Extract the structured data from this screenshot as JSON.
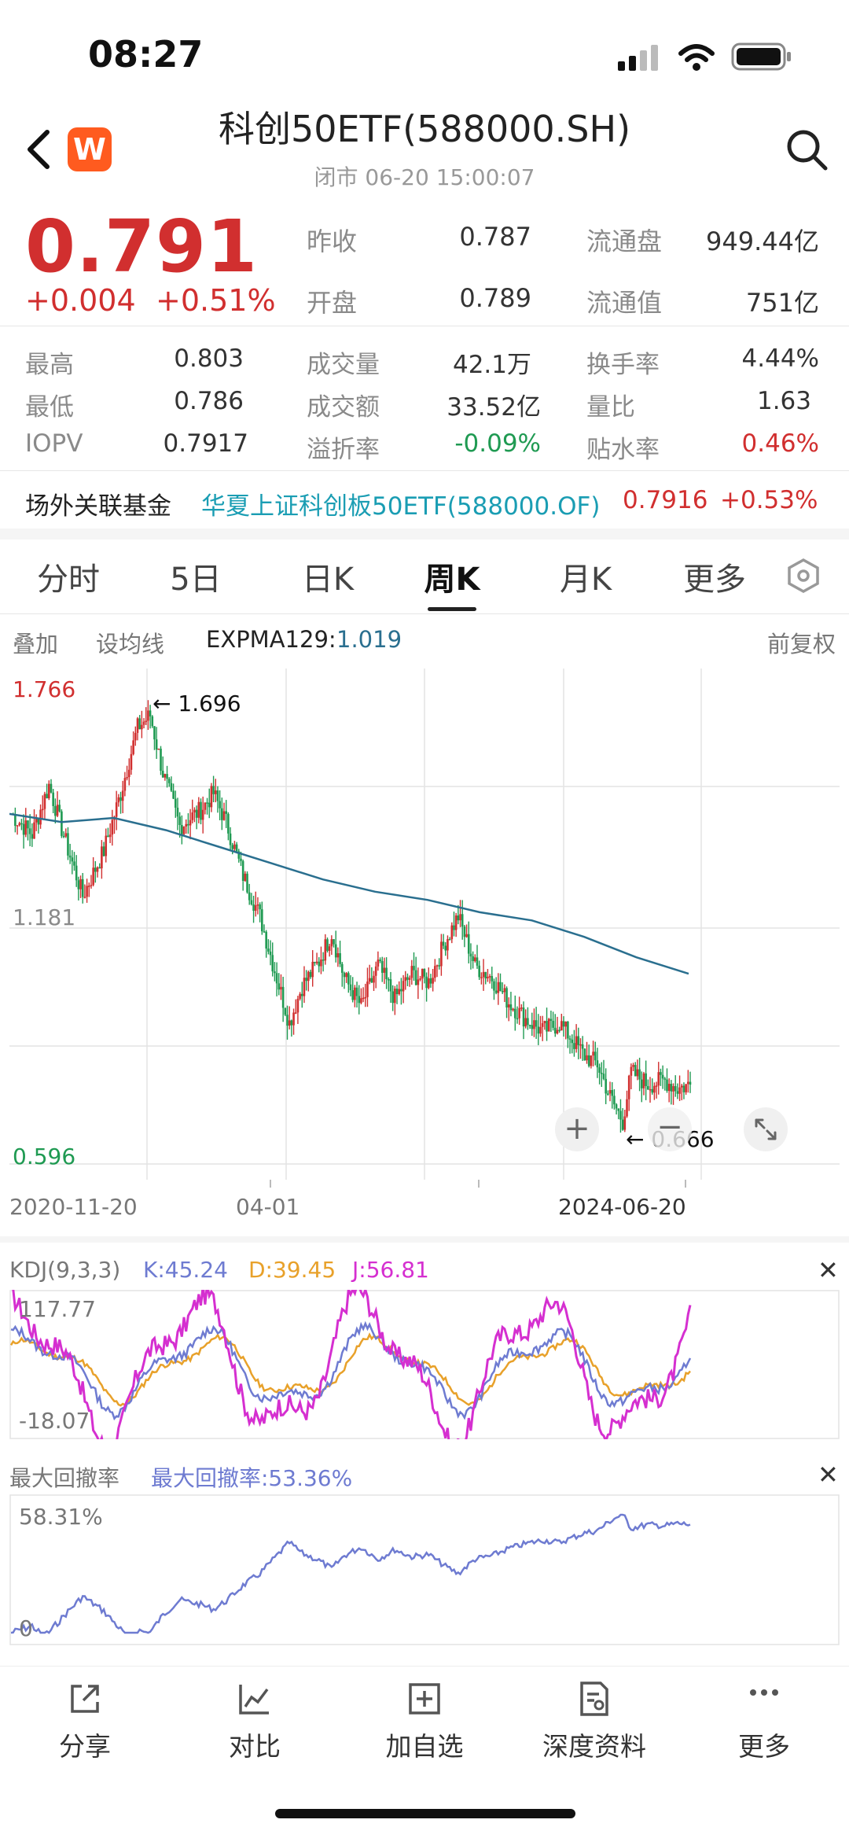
{
  "status_bar": {
    "time": "08:27"
  },
  "header": {
    "title": "科创50ETF(588000.SH)",
    "subtitle": "闭市 06-20 15:00:07",
    "logo_letter": "W"
  },
  "quote": {
    "price": "0.791",
    "change": "+0.004",
    "change_pct": "+0.51%",
    "prev_close_label": "昨收",
    "prev_close": "0.787",
    "open_label": "开盘",
    "open": "0.789",
    "float_shares_label": "流通盘",
    "float_shares": "949.44亿",
    "float_value_label": "流通值",
    "float_value": "751亿"
  },
  "stats": {
    "high_label": "最高",
    "high": "0.803",
    "low_label": "最低",
    "low": "0.786",
    "iopv_label": "IOPV",
    "iopv": "0.7917",
    "volume_label": "成交量",
    "volume": "42.1万",
    "amount_label": "成交额",
    "amount": "33.52亿",
    "premium_label": "溢折率",
    "premium": "-0.09%",
    "turnover_label": "换手率",
    "turnover": "4.44%",
    "vol_ratio_label": "量比",
    "vol_ratio": "1.63",
    "discount_label": "贴水率",
    "discount": "0.46%"
  },
  "related_fund": {
    "label": "场外关联基金",
    "name": "华夏上证科创板50ETF(588000.OF)",
    "price": "0.7916",
    "change": "+0.53%"
  },
  "tabs": [
    {
      "label": "分时"
    },
    {
      "label": "5日"
    },
    {
      "label": "日K"
    },
    {
      "label": "周K"
    },
    {
      "label": "月K"
    },
    {
      "label": "更多"
    }
  ],
  "chart_toolbar": {
    "overlay": "叠加",
    "set_ma": "设均线",
    "expma_label": "EXPMA129:",
    "expma_value": "1.019",
    "adjust": "前复权"
  },
  "kline": {
    "y_top": "1.766",
    "y_mid": "1.181",
    "y_bottom": "0.596",
    "max_marker": "1.696",
    "min_marker": "0.666",
    "x_start": "2020-11-20",
    "x_mid": "04-01",
    "x_end": "2024-06-20",
    "colors": {
      "up": "#d12f2f",
      "down": "#1f9a52",
      "ema": "#2a6f8f"
    }
  },
  "kdj": {
    "title": "KDJ(9,3,3)",
    "k_label": "K:45.24",
    "d_label": "D:39.45",
    "j_label": "J:56.81",
    "y_top": "117.77",
    "y_bottom": "-18.07",
    "colors": {
      "k": "#6e7bd1",
      "d": "#e8a12a",
      "j": "#d52fd0"
    }
  },
  "drawdown": {
    "title": "最大回撤率",
    "value_label": "最大回撤率:53.36%",
    "y_top": "58.31%",
    "y_bottom": "0",
    "color": "#6e7bd1"
  },
  "chart_data": [
    {
      "type": "line",
      "title": "",
      "series": [
        {
          "name": "EXPMA129",
          "values": [
            1.45,
            1.43,
            1.44,
            1.41,
            1.37,
            1.33,
            1.29,
            1.26,
            1.24,
            1.21,
            1.19,
            1.15,
            1.1,
            1.06
          ]
        }
      ],
      "x": [
        "2020-11-20",
        "",
        "",
        "",
        "",
        "",
        "",
        "",
        "",
        "",
        "",
        "",
        "",
        "2024-06-20"
      ],
      "ylim": [
        0.596,
        1.766
      ]
    },
    {
      "type": "line",
      "title": "KDJ(9,3,3)",
      "series": [
        {
          "name": "K",
          "values": [
            45.24
          ]
        },
        {
          "name": "D",
          "values": [
            39.45
          ]
        },
        {
          "name": "J",
          "values": [
            56.81
          ]
        }
      ],
      "ylim": [
        -18.07,
        117.77
      ]
    },
    {
      "type": "line",
      "title": "最大回撤率",
      "series": [
        {
          "name": "最大回撤率",
          "values": [
            53.36
          ]
        }
      ],
      "ylim": [
        0,
        58.31
      ]
    }
  ],
  "bottom_nav": [
    {
      "label": "分享",
      "icon": "share-icon"
    },
    {
      "label": "对比",
      "icon": "compare-icon"
    },
    {
      "label": "加自选",
      "icon": "add-watchlist-icon"
    },
    {
      "label": "深度资料",
      "icon": "research-icon"
    },
    {
      "label": "更多",
      "icon": "more-icon"
    }
  ]
}
